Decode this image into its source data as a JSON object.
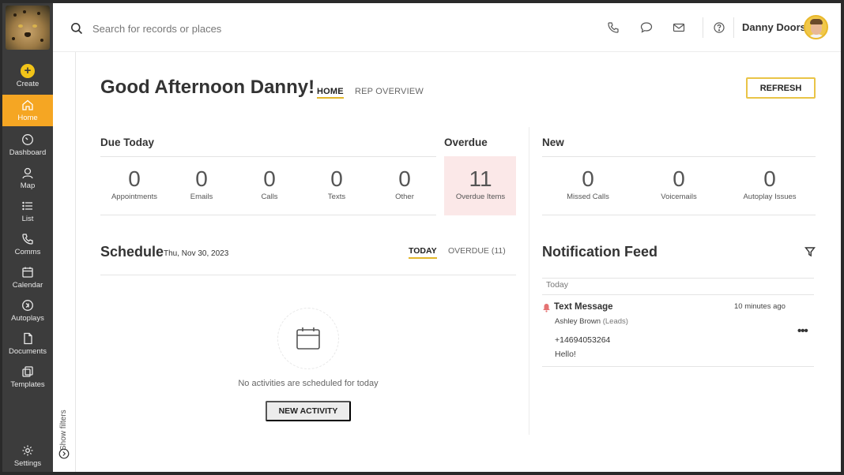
{
  "sidebar": {
    "items": [
      {
        "key": "create",
        "label": "Create"
      },
      {
        "key": "home",
        "label": "Home",
        "active": true
      },
      {
        "key": "dashboard",
        "label": "Dashboard"
      },
      {
        "key": "map",
        "label": "Map"
      },
      {
        "key": "list",
        "label": "List"
      },
      {
        "key": "comms",
        "label": "Comms"
      },
      {
        "key": "calendar",
        "label": "Calendar"
      },
      {
        "key": "autoplays",
        "label": "Autoplays"
      },
      {
        "key": "documents",
        "label": "Documents"
      },
      {
        "key": "templates",
        "label": "Templates"
      },
      {
        "key": "settings",
        "label": "Settings"
      }
    ]
  },
  "topbar": {
    "search_placeholder": "Search for records or places",
    "user_name": "Danny Doors",
    "icons": [
      "phone-icon",
      "chat-icon",
      "mail-icon",
      "help-icon"
    ]
  },
  "filters": {
    "label": "Show filters"
  },
  "header": {
    "greeting": "Good Afternoon Danny!",
    "tabs": [
      {
        "label": "HOME",
        "active": true
      },
      {
        "label": "REP OVERVIEW"
      }
    ],
    "refresh_label": "REFRESH"
  },
  "due_today": {
    "title": "Due Today",
    "stats": [
      {
        "value": "0",
        "label": "Appointments"
      },
      {
        "value": "0",
        "label": "Emails"
      },
      {
        "value": "0",
        "label": "Calls"
      },
      {
        "value": "0",
        "label": "Texts"
      },
      {
        "value": "0",
        "label": "Other"
      }
    ]
  },
  "overdue": {
    "title": "Overdue",
    "value": "11",
    "label": "Overdue Items"
  },
  "new": {
    "title": "New",
    "stats": [
      {
        "value": "0",
        "label": "Missed Calls"
      },
      {
        "value": "0",
        "label": "Voicemails"
      },
      {
        "value": "0",
        "label": "Autoplay Issues"
      }
    ]
  },
  "schedule": {
    "title": "Schedule",
    "date": "Thu, Nov 30, 2023",
    "tabs": [
      {
        "label": "TODAY",
        "active": true
      },
      {
        "label": "OVERDUE (11)"
      }
    ],
    "empty_text": "No activities are scheduled for today",
    "new_activity_label": "NEW ACTIVITY"
  },
  "notifications": {
    "title": "Notification Feed",
    "group_label": "Today",
    "items": [
      {
        "title": "Text Message",
        "time": "10 minutes ago",
        "sender": "Ashley Brown",
        "sender_tag": "(Leads)",
        "phone": "+14694053264",
        "body": "Hello!"
      }
    ]
  },
  "colors": {
    "accent": "#f5a623",
    "sidebar": "#3c3c3c",
    "overdue_bg": "#fbe8e8",
    "tab_underline": "#e2b62a"
  }
}
